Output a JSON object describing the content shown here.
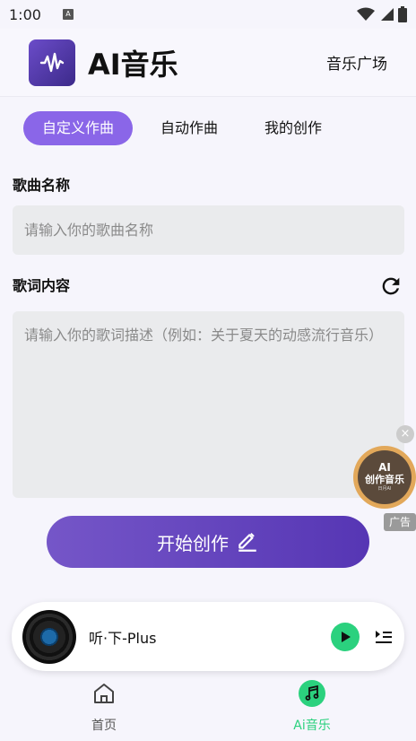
{
  "status": {
    "time": "1:00",
    "app_icon": "A"
  },
  "header": {
    "title": "AI音乐",
    "market_link": "音乐广场"
  },
  "tabs": [
    {
      "label": "自定义作曲",
      "active": true
    },
    {
      "label": "自动作曲",
      "active": false
    },
    {
      "label": "我的创作",
      "active": false
    }
  ],
  "song_name": {
    "label": "歌曲名称",
    "placeholder": "请输入你的歌曲名称",
    "value": ""
  },
  "lyrics": {
    "label": "歌词内容",
    "placeholder": "请输入你的歌词描述（例如：关于夏天的动感流行音乐）",
    "value": ""
  },
  "start_button": {
    "label": "开始创作"
  },
  "ad": {
    "close": "×",
    "ai": "AI",
    "name": "创作音乐",
    "sub": "日月AI",
    "tag": "广告"
  },
  "player": {
    "track": "听·下-Plus"
  },
  "nav": [
    {
      "label": "首页",
      "active": false
    },
    {
      "label": "Ai音乐",
      "active": true
    }
  ],
  "colors": {
    "accent": "#8a66e8",
    "green": "#2bd17e",
    "button_start": "#7556c8",
    "button_end": "#5636b4"
  },
  "icons": [
    "wifi-icon",
    "signal-icon",
    "battery-icon",
    "waveform-icon",
    "refresh-icon",
    "edit-icon",
    "play-icon",
    "queue-icon",
    "home-icon",
    "music-note-icon"
  ]
}
